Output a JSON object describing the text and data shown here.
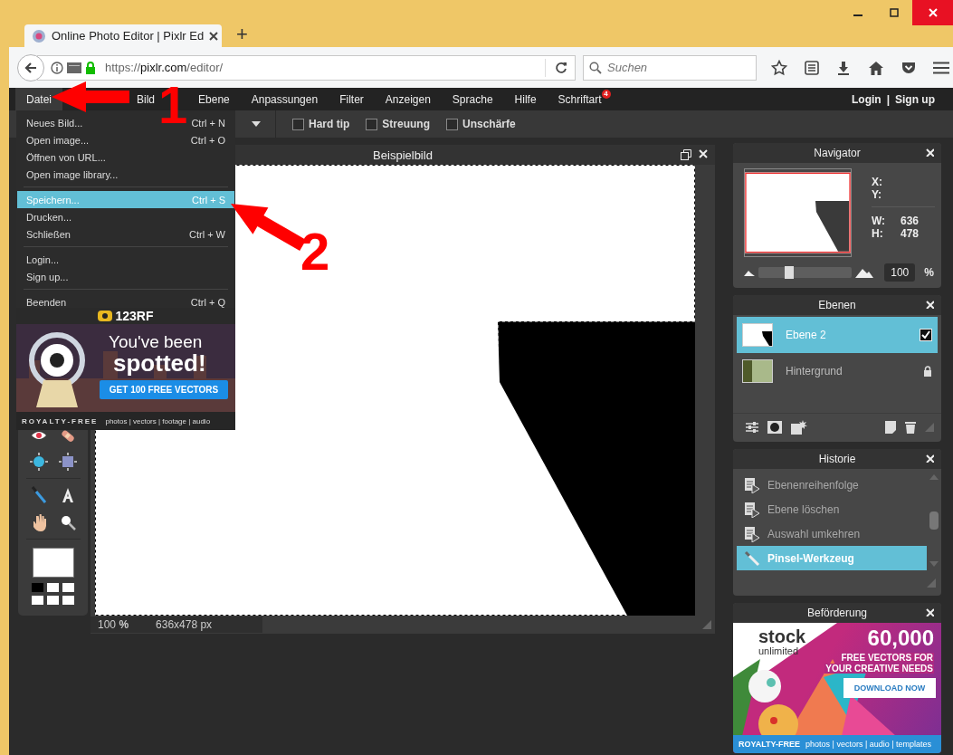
{
  "browser": {
    "tab_title": "Online Photo Editor | Pixlr Ed",
    "new_tab": "+",
    "url_scheme": "https://",
    "url_domain": "pixlr.com",
    "url_path": "/editor/",
    "search_placeholder": "Suchen"
  },
  "menubar": {
    "items": [
      {
        "label": "Datei",
        "selected": true
      },
      {
        "label": "Bild",
        "selected": false
      },
      {
        "label": "Ebene",
        "selected": false
      },
      {
        "label": "Anpassungen",
        "selected": false
      },
      {
        "label": "Filter",
        "selected": false
      },
      {
        "label": "Anzeigen",
        "selected": false
      },
      {
        "label": "Sprache",
        "selected": false
      },
      {
        "label": "Hilfe",
        "selected": false
      },
      {
        "label": "Schriftart",
        "selected": false,
        "badge": "4"
      }
    ],
    "login": "Login",
    "separator": "|",
    "signup": "Sign up"
  },
  "toolbar": {
    "options": [
      {
        "label": "Hard tip",
        "checked": false
      },
      {
        "label": "Streuung",
        "checked": false
      },
      {
        "label": "Unschärfe",
        "checked": false
      }
    ]
  },
  "file_menu": {
    "groups": [
      {
        "items": [
          {
            "label": "Neues Bild...",
            "shortcut": "Ctrl + N",
            "selected": false
          },
          {
            "label": "Open image...",
            "shortcut": "Ctrl + O",
            "selected": false
          },
          {
            "label": "Öffnen von URL...",
            "selected": false
          },
          {
            "label": "Open image library...",
            "selected": false
          }
        ]
      },
      {
        "items": [
          {
            "label": "Speichern...",
            "shortcut": "Ctrl + S",
            "selected": true
          },
          {
            "label": "Drucken...",
            "selected": false
          },
          {
            "label": "Schließen",
            "shortcut": "Ctrl + W",
            "selected": false
          }
        ]
      },
      {
        "items": [
          {
            "label": "Login...",
            "selected": false
          },
          {
            "label": "Sign up...",
            "selected": false
          }
        ]
      },
      {
        "items": [
          {
            "label": "Beenden",
            "shortcut": "Ctrl + Q",
            "selected": false
          }
        ]
      }
    ]
  },
  "menu_ad": {
    "brand": "123RF",
    "headline": "You've been",
    "headline_bold": "spotted!",
    "button": "GET 100 FREE VECTORS",
    "footer_label": "ROYALTY-FREE",
    "footer_links": "photos | vectors | footage | audio"
  },
  "tools": {
    "swatches": [
      {
        "color": "#000000"
      },
      {
        "color": "#ffffff"
      },
      {
        "color": "#ffffff"
      },
      {
        "color": "#ffffff"
      },
      {
        "color": "#ffffff"
      },
      {
        "color": "#ffffff"
      }
    ]
  },
  "image_window": {
    "title": "Beispielbild",
    "zoom": "100",
    "zoom_unit": "%",
    "dimensions": "636x478 px"
  },
  "navigator": {
    "title": "Navigator",
    "x_label": "X:",
    "y_label": "Y:",
    "w_label": "W:",
    "w_value": "636",
    "h_label": "H:",
    "h_value": "478",
    "zoom": {
      "level": 0.3,
      "value": "100",
      "unit": "%"
    }
  },
  "layers": {
    "title": "Ebenen",
    "items": [
      {
        "name": "Ebene 2",
        "kind": "drawing",
        "selected": true,
        "checked": true,
        "locked": false
      },
      {
        "name": "Hintergrund",
        "kind": "photo",
        "selected": false,
        "checked": false,
        "locked": true
      }
    ]
  },
  "history": {
    "title": "Historie",
    "items": [
      {
        "label": "Ebenenreihenfolge",
        "kind": "layer",
        "selected": false
      },
      {
        "label": "Ebene löschen",
        "kind": "layer",
        "selected": false
      },
      {
        "label": "Auswahl umkehren",
        "kind": "layer",
        "selected": false
      },
      {
        "label": "Pinsel-Werkzeug",
        "kind": "brush",
        "selected": true
      }
    ]
  },
  "promo": {
    "title": "Beförderung",
    "brand": "stock",
    "brand_sub": "unlimited",
    "headline": "60,000",
    "subline_1": "FREE VECTORS FOR",
    "subline_2": "YOUR CREATIVE NEEDS",
    "button": "DOWNLOAD NOW",
    "footer_label": "ROYALTY-FREE",
    "footer_links": "photos | vectors | audio | templates"
  },
  "annotations": [
    {
      "label": "1"
    },
    {
      "label": "2"
    }
  ]
}
